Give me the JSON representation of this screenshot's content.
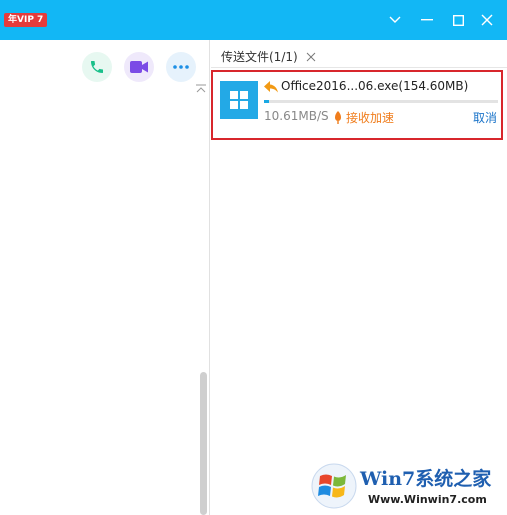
{
  "titlebar": {
    "vip_badge": "年VIP 7",
    "colors": {
      "background": "#12b7f5"
    }
  },
  "left_pane": {
    "actions": [
      {
        "icon": "phone-icon",
        "color": "#19c08a",
        "bg": "#e7f8f1"
      },
      {
        "icon": "video-icon",
        "color": "#7b4be6",
        "bg": "#efe9fb"
      },
      {
        "icon": "more-icon",
        "color": "#1d8fe5",
        "bg": "#e6f2fc"
      }
    ]
  },
  "transfer_panel": {
    "tab_label": "传送文件(1/1)",
    "file": {
      "name": "Office2016...06.exe(154.60MB)",
      "speed": "10.61MB/S",
      "accelerate_label": "接收加速",
      "cancel_label": "取消",
      "progress": 0.02
    }
  },
  "watermark": {
    "title": "Win7系统之家",
    "url": "Www.Winwin7.com"
  }
}
